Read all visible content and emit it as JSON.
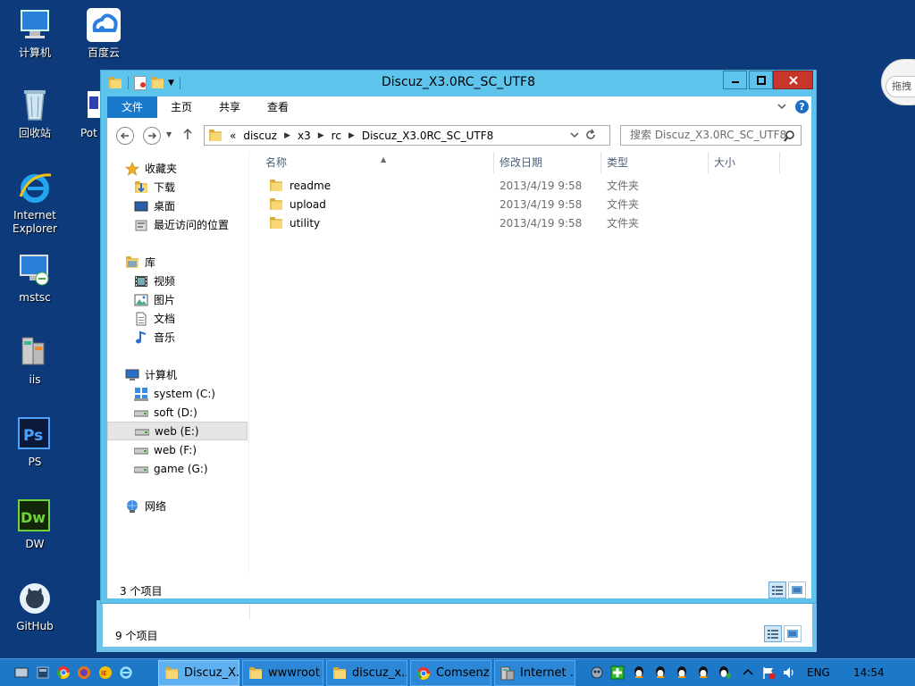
{
  "desktop": {
    "icons": [
      {
        "label": "计算机"
      },
      {
        "label": "百度云"
      },
      {
        "label": "回收站"
      },
      {
        "label": "Pot"
      },
      {
        "label": "Internet Explorer"
      },
      {
        "label": "mstsc"
      },
      {
        "label": "iis"
      },
      {
        "label": "PS"
      },
      {
        "label": "DW"
      },
      {
        "label": "GitHub"
      }
    ]
  },
  "cloud": {
    "label": "拖拽"
  },
  "window": {
    "title": "Discuz_X3.0RC_SC_UTF8",
    "ribbon": {
      "file": "文件",
      "home": "主页",
      "share": "共享",
      "view": "查看",
      "help": "?"
    },
    "address": {
      "prefix": "«",
      "crumbs": [
        "discuz",
        "x3",
        "rc",
        "Discuz_X3.0RC_SC_UTF8"
      ]
    },
    "search": {
      "placeholder": "搜索 Discuz_X3.0RC_SC_UTF8"
    },
    "tree": {
      "favorites": "收藏夹",
      "downloads": "下载",
      "desktop": "桌面",
      "recent": "最近访问的位置",
      "libraries": "库",
      "videos": "视频",
      "pictures": "图片",
      "documents": "文档",
      "music": "音乐",
      "computer": "计算机",
      "drives": [
        "system (C:)",
        "soft (D:)",
        "web (E:)",
        "web (F:)",
        "game (G:)"
      ],
      "network": "网络"
    },
    "columns": {
      "name": "名称",
      "date": "修改日期",
      "type": "类型",
      "size": "大小"
    },
    "files": [
      {
        "name": "readme",
        "date": "2013/4/19 9:58",
        "type": "文件夹"
      },
      {
        "name": "upload",
        "date": "2013/4/19 9:58",
        "type": "文件夹"
      },
      {
        "name": "utility",
        "date": "2013/4/19 9:58",
        "type": "文件夹"
      }
    ],
    "status": "3 个项目"
  },
  "back_window": {
    "status": "9 个项目"
  },
  "taskbar": {
    "items": [
      {
        "label": "Discuz_X..."
      },
      {
        "label": "wwwroot"
      },
      {
        "label": "discuz_x..."
      },
      {
        "label": "Comsenz..."
      },
      {
        "label": "Internet ..."
      }
    ],
    "lang": "ENG",
    "time": "14:54"
  }
}
